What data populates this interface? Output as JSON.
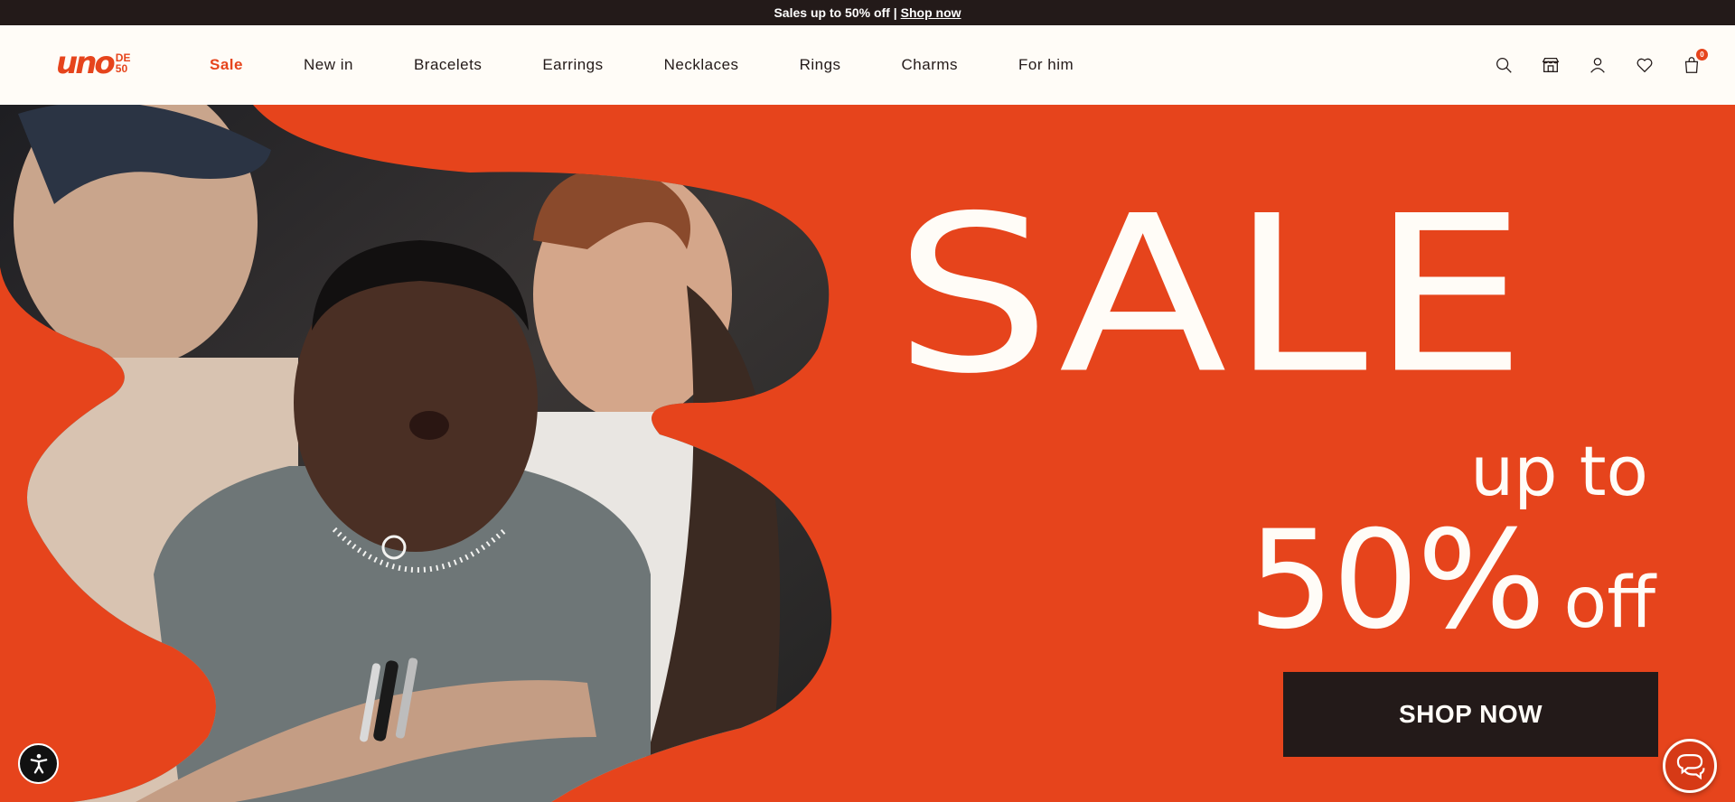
{
  "announcement": {
    "text": "Sales up to 50% off |",
    "link": "Shop now"
  },
  "brand": {
    "logo_main": "uno",
    "logo_sub_1": "DE",
    "logo_sub_2": "50",
    "accent": "#e6441c",
    "dark": "#231a19"
  },
  "nav": {
    "items": [
      {
        "label": "Sale"
      },
      {
        "label": "New in"
      },
      {
        "label": "Bracelets"
      },
      {
        "label": "Earrings"
      },
      {
        "label": "Necklaces"
      },
      {
        "label": "Rings"
      },
      {
        "label": "Charms"
      },
      {
        "label": "For him"
      }
    ]
  },
  "header_icons": {
    "search": "search-icon",
    "store": "store-icon",
    "account": "user-icon",
    "wishlist": "heart-icon",
    "cart": "shopping-bag-icon",
    "cart_count": "0"
  },
  "hero": {
    "title": "SALE",
    "upto": "up to",
    "percent": "50%",
    "off": "off",
    "cta": "SHOP NOW"
  },
  "widgets": {
    "accessibility": "accessibility-icon",
    "chat": "chat-icon"
  }
}
